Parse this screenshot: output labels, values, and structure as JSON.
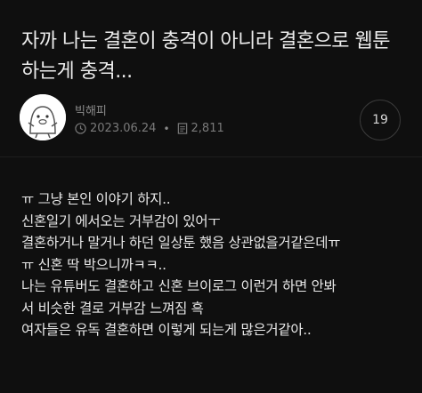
{
  "post": {
    "title_line1": "자까 나는 결혼이 충격이 아니라 결혼으로 웹툰",
    "title_line2": "하는게 충격..."
  },
  "meta": {
    "author": "빅해피",
    "date": "2023.06.24",
    "views": "2,811",
    "comment_count": "19",
    "icons": {
      "date": "clock-icon",
      "views": "document-icon",
      "avatar": "character-avatar"
    }
  },
  "content": {
    "lines": [
      "ㅠ 그냥 본인 이야기 하지..",
      "신혼일기 에서오는 거부감이 있어ㅜ",
      "결혼하거나 말거나 하던 일상툰 했음 상관없을거같은데ㅠ",
      "ㅠ 신혼 딱 박으니까ㅋㅋ..",
      "나는 유튜버도 결혼하고 신혼 브이로그 이런거 하면 안봐",
      "서 비슷한 결로 거부감 느껴짐 흑",
      "여자들은 유독 결혼하면 이렇게 되는게 많은거같아.."
    ]
  }
}
